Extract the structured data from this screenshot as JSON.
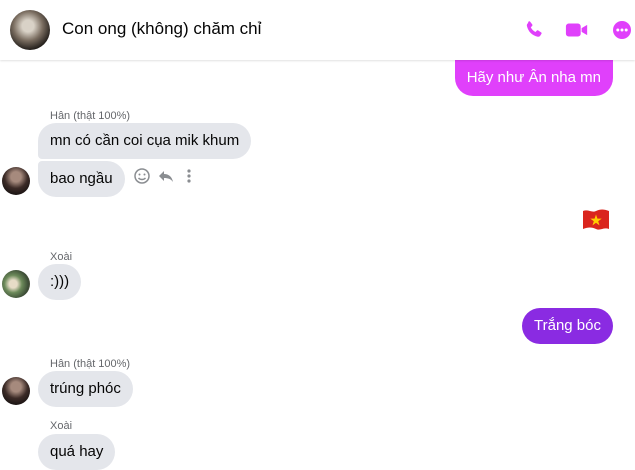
{
  "header": {
    "title": "Con ong (không) chăm chỉ",
    "icons": [
      "phone-icon",
      "video-camera-icon",
      "more-options-icon"
    ],
    "accent_color": "#e040fb"
  },
  "messages": [
    {
      "side": "out",
      "text": "Hãy như Ân nha mn",
      "color": "#e040fb"
    },
    {
      "sender": "Hân (thật 100%)",
      "side": "in",
      "text": "mn có cần coi cụa mik khum"
    },
    {
      "side": "in",
      "text": "bao ngầu"
    },
    {
      "side": "out",
      "text": "🇻🇳",
      "emoji": "vietnam-flag"
    },
    {
      "sender": "Xoài",
      "side": "in",
      "text": ":)))"
    },
    {
      "side": "out",
      "text": "Trắng bóc",
      "color": "#8a2be2"
    },
    {
      "sender": "Hân (thật 100%)",
      "side": "in",
      "text": "trúng phóc"
    },
    {
      "sender": "Xoài",
      "side": "in",
      "text": "quá hay"
    }
  ],
  "hover_actions": [
    "react-icon",
    "reply-icon",
    "more-icon"
  ]
}
